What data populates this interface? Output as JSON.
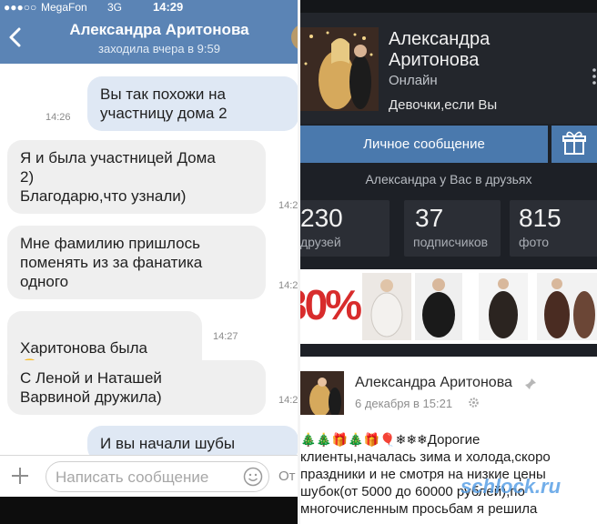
{
  "chat": {
    "status_bar": {
      "dots": "●●●○○",
      "carrier": "MegaFon",
      "network": "3G",
      "time": "14:29"
    },
    "header": {
      "name": "Александра Аритонова",
      "last_seen": "заходила вчера в 9:59"
    },
    "messages": [
      {
        "direction": "out",
        "text": "Вы так похожи на\nучастницу дома 2",
        "time": "14:26"
      },
      {
        "direction": "in",
        "text": "Я и была участницей Дома\n2)\nБлагодарю,что узнали)",
        "time": "14:2"
      },
      {
        "direction": "in",
        "text": "Мне фамилию пришлось\nпоменять из за фанатика\nодного",
        "time": "14:2"
      },
      {
        "direction": "in",
        "text": "Харитонова была",
        "time": "14:27"
      },
      {
        "direction": "in",
        "text": "С Леной и Наташей\nВарвиной дружила)",
        "time": "14:2"
      },
      {
        "direction": "out",
        "text": "И вы начали шубы",
        "time": ""
      }
    ],
    "input": {
      "placeholder": "Написать сообщение",
      "send_label": "От"
    }
  },
  "profile": {
    "name": "Александра\nАритонова",
    "status": "Онлайн",
    "bio": "Девочки,если Вы",
    "message_button": "Личное сообщение",
    "friends_note": "Александра у Вас в друзьях",
    "stats": [
      {
        "value": "230",
        "label": "друзей"
      },
      {
        "value": "37",
        "label": "подписчиков"
      },
      {
        "value": "815",
        "label": "фото"
      }
    ],
    "photo_strip_sale": "30%",
    "post": {
      "author": "Александра Аритонова",
      "date": "6 декабря в 15:21",
      "emojis": "🎄🎄🎁🎄🎁🎈❄❄❄",
      "text": "Дорогие\nклиенты,началась зима и холода,скоро\nпраздники и не смотря на низкие цены\nшубок(от 5000 до 60000 рублей),по\nмногочисленным просьбам я решила"
    },
    "watermark": "schlock.ru"
  },
  "colors": {
    "vk_header": "#5b84b5",
    "bubble_out": "#dfe8f4",
    "bubble_in": "#efefef",
    "profile_bg": "#1d2026",
    "button_blue": "#4a79ad"
  }
}
